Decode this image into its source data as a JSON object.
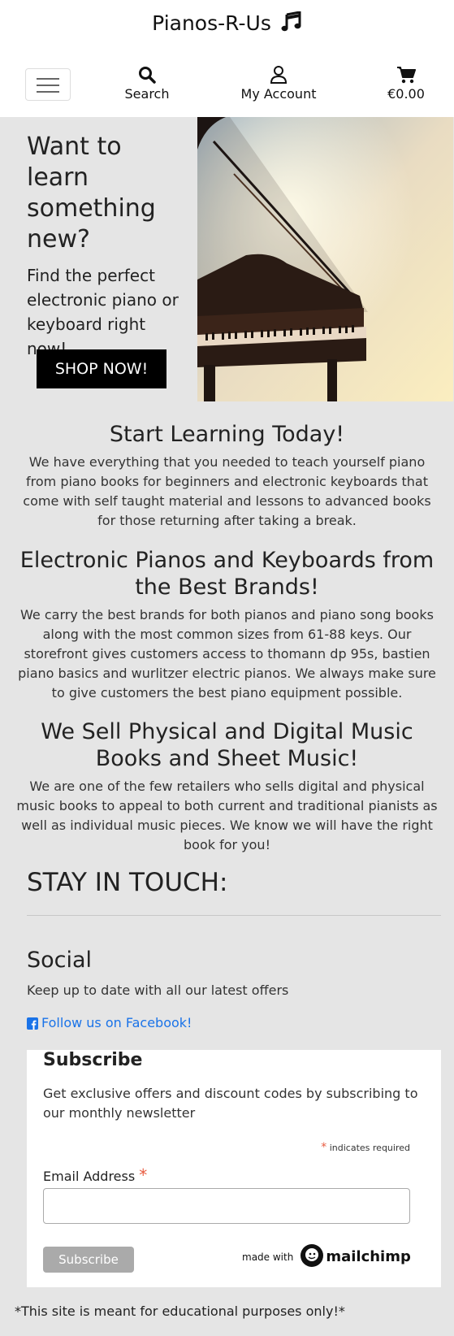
{
  "header": {
    "brand": "Pianos-R-Us",
    "nav": {
      "search_label": "Search",
      "account_label": "My Account",
      "cart_label": "€0.00"
    }
  },
  "hero": {
    "title": "Want to learn something new?",
    "subtitle": "Find the perfect electronic piano or keyboard right now!",
    "cta": "SHOP NOW!"
  },
  "sections": [
    {
      "heading": "Start Learning Today!",
      "body": "We have everything that you needed to teach yourself piano from piano books for beginners and electronic keyboards that come with self taught material and lessons to advanced books for those returning after taking a break."
    },
    {
      "heading": "Electronic Pianos and Keyboards from the Best Brands!",
      "body": "We carry the best brands for both pianos and piano song books along with the most common sizes from 61-88 keys. Our storefront gives customers access to thomann dp 95s, bastien piano basics and wurlitzer electric pianos. We always make sure to give customers the best piano equipment possible."
    },
    {
      "heading": "We Sell Physical and Digital Music Books and Sheet Music!",
      "body": "We are one of the few retailers who sells digital and physical music books to appeal to both current and traditional pianists as well as individual music pieces. We know we will have the right book for you!"
    }
  ],
  "contact": {
    "heading": "STAY IN TOUCH:",
    "social_heading": "Social",
    "social_text": "Keep up to date with all our latest offers",
    "facebook_link": "Follow us on Facebook!"
  },
  "subscribe": {
    "heading": "Subscribe",
    "text": "Get exclusive offers and discount codes by subscribing to our monthly newsletter",
    "required_note": "indicates required",
    "required_mark": "*",
    "email_label": "Email Address",
    "email_value": "",
    "button": "Subscribe",
    "made_with": "made with",
    "mailchimp": "mailchimp"
  },
  "footer": {
    "note": "*This site is meant for educational purposes only!*"
  },
  "colors": {
    "background": "#e5e5e5",
    "link": "#1a73e8",
    "required": "#e85c41",
    "cta": "#000000"
  }
}
